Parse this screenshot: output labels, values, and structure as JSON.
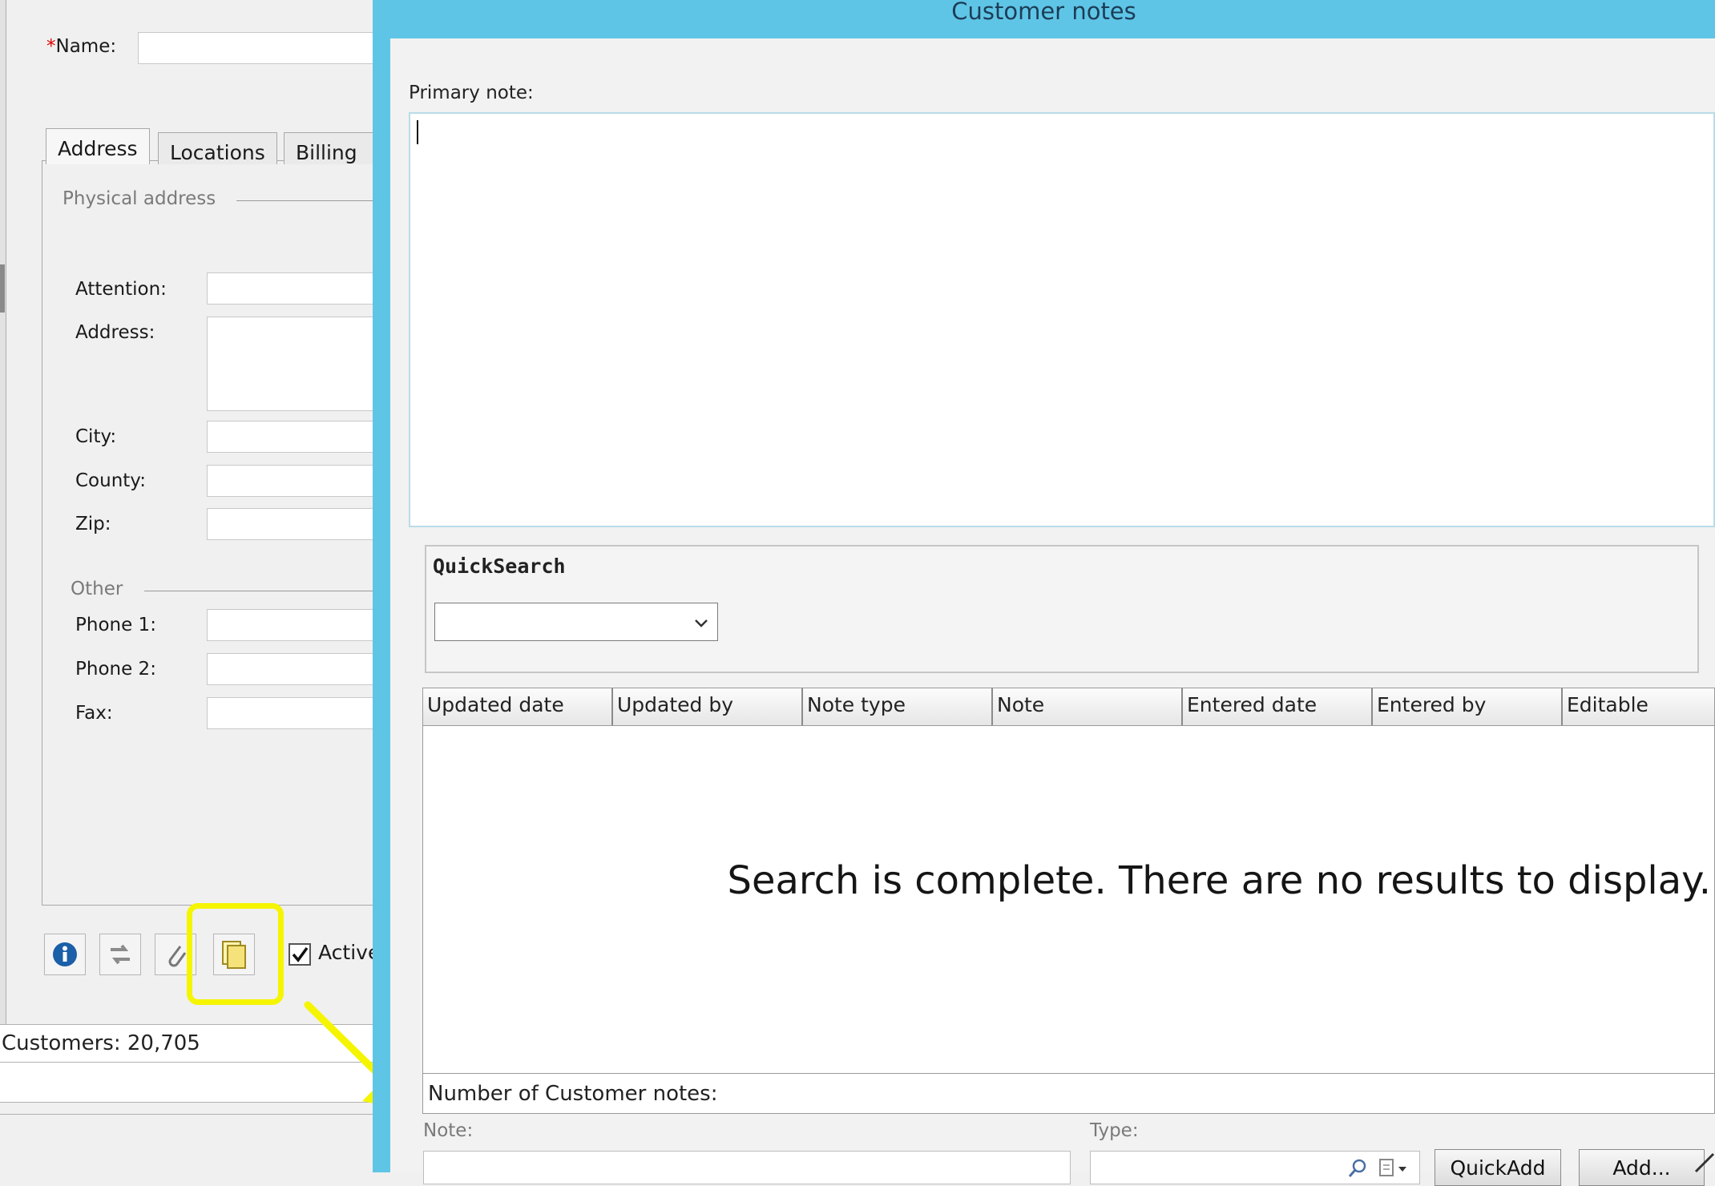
{
  "customer_form": {
    "name_required_mark": "*",
    "name_label": "Name:",
    "tabs": [
      "Address",
      "Locations",
      "Billing"
    ],
    "physical_address_label": "Physical address",
    "fields": {
      "attention": "Attention:",
      "address": "Address:",
      "city": "City:",
      "county": "County:",
      "zip": "Zip:"
    },
    "other_label": "Other",
    "phones": {
      "phone1": "Phone 1:",
      "phone2": "Phone 2:",
      "fax": "Fax:"
    },
    "active_label": "Active",
    "active_checked": true,
    "toolbar_icons": [
      "info-icon",
      "swap-arrows-icon",
      "attachment-icon",
      "notes-icon"
    ],
    "status_count": "Customers: 20,705",
    "highlight_color": "#f5f500"
  },
  "notes_dialog": {
    "title": "Customer notes",
    "primary_note_label": "Primary note:",
    "primary_note_value": "",
    "quicksearch_label": "QuickSearch",
    "quicksearch_value": "",
    "columns": [
      "Updated date",
      "Updated by",
      "Note type",
      "Note",
      "Entered date",
      "Entered by",
      "Editable"
    ],
    "rows": [],
    "empty_message": "Search is complete. There are no results to display.",
    "count_label": "Number of Customer notes:",
    "note_label": "Note:",
    "note_value": "",
    "type_label": "Type:",
    "type_value": "",
    "quickadd_label": "QuickAdd",
    "add_label": "Add...",
    "title_bar_color": "#5fc5e6"
  }
}
